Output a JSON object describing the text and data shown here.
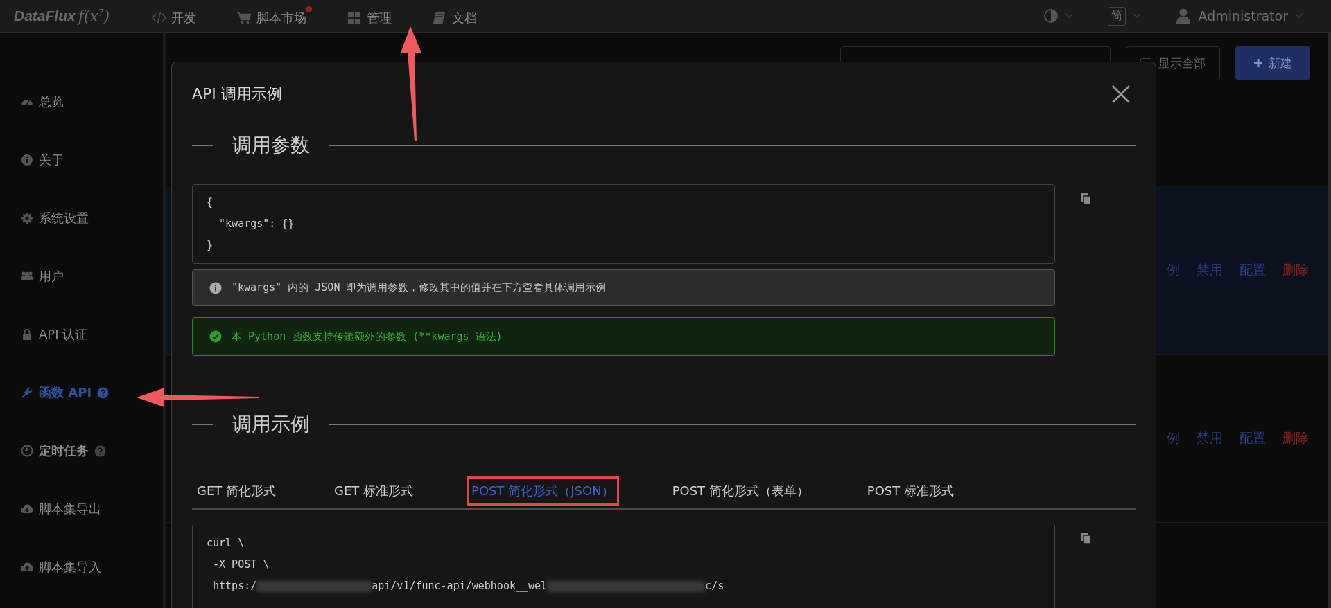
{
  "topbar": {
    "logo": "DataFlux",
    "logo_mark": "f(x$^{7}$)",
    "nav": [
      {
        "label": "开发",
        "badge": false
      },
      {
        "label": "脚本市场",
        "badge": true
      },
      {
        "label": "管理",
        "badge": false
      },
      {
        "label": "文档",
        "badge": false
      }
    ],
    "language": "简",
    "user": "Administrator"
  },
  "sidebar": {
    "items": [
      {
        "label": "总览",
        "selected": false,
        "bold": false,
        "help": false
      },
      {
        "label": "关于",
        "selected": false,
        "bold": false,
        "help": false
      },
      {
        "label": "系统设置",
        "selected": false,
        "bold": false,
        "help": false
      },
      {
        "label": "用户",
        "selected": false,
        "bold": false,
        "help": false
      },
      {
        "label": "API 认证",
        "selected": false,
        "bold": false,
        "help": false
      },
      {
        "label": "函数 API",
        "selected": true,
        "bold": true,
        "help": true
      },
      {
        "label": "定时任务",
        "selected": false,
        "bold": true,
        "help": true
      },
      {
        "label": "脚本集导出",
        "selected": false,
        "bold": false,
        "help": false
      },
      {
        "label": "脚本集导入",
        "selected": false,
        "bold": false,
        "help": false
      }
    ]
  },
  "annotations": [
    {
      "kind": "arrow_up"
    },
    {
      "kind": "arrow_left"
    }
  ],
  "page": {
    "show_all": {
      "label": "显示全部",
      "checked": false
    },
    "new_button": "新建",
    "rows": [
      {
        "selected": true,
        "actions": [
          {
            "label": "例",
            "kind": "link"
          },
          {
            "label": "禁用",
            "kind": "link"
          },
          {
            "label": "配置",
            "kind": "link"
          },
          {
            "label": "删除",
            "kind": "danger"
          }
        ]
      },
      {
        "selected": false,
        "actions": [
          {
            "label": "例",
            "kind": "link"
          },
          {
            "label": "禁用",
            "kind": "link"
          },
          {
            "label": "配置",
            "kind": "link"
          },
          {
            "label": "删除",
            "kind": "danger"
          }
        ]
      }
    ]
  },
  "dialog": {
    "title": "API 调用示例",
    "params_section": {
      "title": "调用参数",
      "code": [
        "{",
        "  \"kwargs\": {}",
        "}"
      ],
      "info": "\"kwargs\" 内的 JSON 即为调用参数，修改其中的值并在下方查看具体调用示例",
      "success": "本 Python 函数支持传递额外的参数 (**kwargs 语法)"
    },
    "example_section": {
      "title": "调用示例",
      "tabs": [
        {
          "label": "GET 简化形式",
          "selected": false,
          "highlighted": false
        },
        {
          "label": "GET 标准形式",
          "selected": false,
          "highlighted": false
        },
        {
          "label": "POST 简化形式（JSON）",
          "selected": true,
          "highlighted": true
        },
        {
          "label": "POST 简化形式（表单）",
          "selected": false,
          "highlighted": false
        },
        {
          "label": "POST 标准形式",
          "selected": false,
          "highlighted": false
        }
      ],
      "code": [
        {
          "segments": [
            {
              "kind": "text",
              "text": "curl \\"
            }
          ]
        },
        {
          "segments": [
            {
              "kind": "text",
              "text": " -X POST \\"
            }
          ]
        },
        {
          "segments": [
            {
              "kind": "text",
              "text": " https:/"
            },
            {
              "kind": "redacted"
            },
            {
              "kind": "text",
              "text": "api/v1/func-api/webhook__wel"
            },
            {
              "kind": "redacted"
            },
            {
              "kind": "text",
              "text": "c/s"
            }
          ]
        }
      ]
    }
  }
}
